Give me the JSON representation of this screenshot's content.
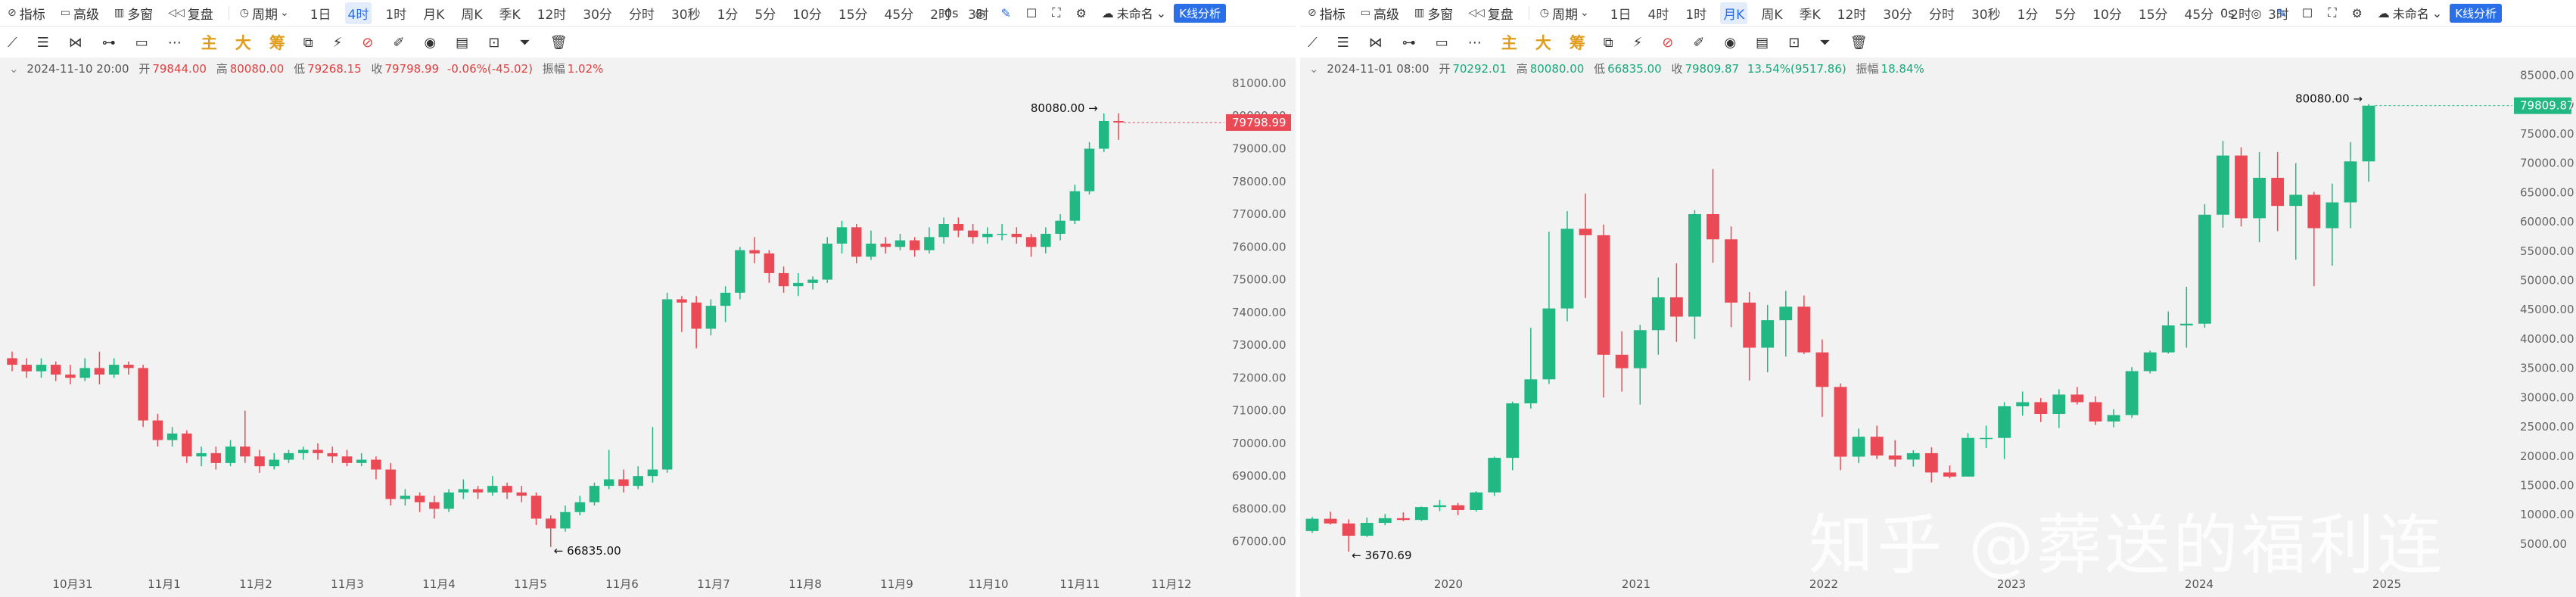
{
  "toolbar": {
    "indicator": "指标",
    "advanced": "高级",
    "multi_window": "多窗",
    "replay": "复盘",
    "period_menu": "周期",
    "unnamed": "未命名",
    "kline_analysis": "K线分析",
    "right_speed": "0s",
    "tools": [
      "主",
      "大",
      "筹"
    ]
  },
  "left": {
    "periods": [
      "1日",
      "4时",
      "1时",
      "月K",
      "周K",
      "季K",
      "12时",
      "30分",
      "分时",
      "30秒",
      "1分",
      "5分",
      "10分",
      "15分",
      "45分",
      "2时",
      "3时"
    ],
    "active_period": "4时",
    "info": {
      "datetime": "2024-11-10 20:00",
      "open_label": "开",
      "open": "79844.00",
      "high_label": "高",
      "high": "80080.00",
      "low_label": "低",
      "low": "79268.15",
      "close_label": "收",
      "close": "79798.99",
      "change": "-0.06%(-45.02)",
      "amp_label": "振幅",
      "amp": "1.02%"
    },
    "chart_data": {
      "type": "candlestick",
      "y_ticks": [
        81000,
        80000,
        79000,
        78000,
        77000,
        76000,
        75000,
        74000,
        73000,
        72000,
        71000,
        70000,
        69000,
        68000,
        67000
      ],
      "ylim": [
        66300,
        81600
      ],
      "x_ticks": [
        "10月31",
        "11月1",
        "11月2",
        "11月3",
        "11月4",
        "11月5",
        "11月6",
        "11月7",
        "11月8",
        "11月9",
        "11月10",
        "11月11",
        "11月12"
      ],
      "last_price": "79798.99",
      "high_label": "80080.00",
      "low_label": "66835.00",
      "candles": [
        [
          72600,
          72400,
          72800,
          72200
        ],
        [
          72400,
          72200,
          72600,
          72000
        ],
        [
          72200,
          72400,
          72600,
          72000
        ],
        [
          72400,
          72100,
          72500,
          71900
        ],
        [
          72100,
          72000,
          72400,
          71800
        ],
        [
          72000,
          72300,
          72600,
          71900
        ],
        [
          72300,
          72100,
          72800,
          71800
        ],
        [
          72100,
          72400,
          72600,
          72000
        ],
        [
          72400,
          72300,
          72500,
          72100
        ],
        [
          72300,
          70700,
          72400,
          70500
        ],
        [
          70700,
          70100,
          70900,
          69900
        ],
        [
          70100,
          70300,
          70500,
          69900
        ],
        [
          70300,
          69600,
          70400,
          69400
        ],
        [
          69600,
          69700,
          69900,
          69300
        ],
        [
          69700,
          69400,
          69900,
          69200
        ],
        [
          69400,
          69900,
          70100,
          69300
        ],
        [
          69900,
          69600,
          71000,
          69400
        ],
        [
          69600,
          69300,
          69800,
          69100
        ],
        [
          69300,
          69500,
          69700,
          69200
        ],
        [
          69500,
          69700,
          69800,
          69400
        ],
        [
          69700,
          69800,
          69900,
          69500
        ],
        [
          69800,
          69700,
          70000,
          69500
        ],
        [
          69700,
          69600,
          69900,
          69400
        ],
        [
          69600,
          69400,
          69800,
          69300
        ],
        [
          69400,
          69500,
          69700,
          69300
        ],
        [
          69500,
          69200,
          69600,
          68900
        ],
        [
          69200,
          68300,
          69400,
          68100
        ],
        [
          68300,
          68400,
          68600,
          68100
        ],
        [
          68400,
          68200,
          68500,
          67900
        ],
        [
          68200,
          68000,
          68400,
          67700
        ],
        [
          68000,
          68500,
          68600,
          67900
        ],
        [
          68500,
          68600,
          68900,
          68300
        ],
        [
          68600,
          68500,
          68700,
          68300
        ],
        [
          68500,
          68700,
          69000,
          68400
        ],
        [
          68700,
          68500,
          68800,
          68300
        ],
        [
          68500,
          68400,
          68700,
          68200
        ],
        [
          68400,
          67700,
          68500,
          67500
        ],
        [
          67700,
          67400,
          67800,
          66835
        ],
        [
          67400,
          67900,
          68100,
          67300
        ],
        [
          67900,
          68200,
          68400,
          67800
        ],
        [
          68200,
          68700,
          68800,
          68100
        ],
        [
          68700,
          68900,
          69800,
          68600
        ],
        [
          68900,
          68700,
          69200,
          68500
        ],
        [
          68700,
          69000,
          69300,
          68600
        ],
        [
          69000,
          69200,
          70500,
          68800
        ],
        [
          69200,
          74400,
          74600,
          69100
        ],
        [
          74400,
          74300,
          74500,
          73400
        ],
        [
          74300,
          73500,
          74500,
          72900
        ],
        [
          73500,
          74200,
          74400,
          73300
        ],
        [
          74200,
          74600,
          74800,
          73700
        ],
        [
          74600,
          75900,
          76000,
          74400
        ],
        [
          75900,
          75800,
          76300,
          75500
        ],
        [
          75800,
          75200,
          75900,
          74900
        ],
        [
          75200,
          74800,
          75400,
          74600
        ],
        [
          74800,
          74900,
          75200,
          74500
        ],
        [
          74900,
          75000,
          75100,
          74700
        ],
        [
          75000,
          76100,
          76300,
          74900
        ],
        [
          76100,
          76600,
          76800,
          75800
        ],
        [
          76600,
          75700,
          76700,
          75500
        ],
        [
          75700,
          76100,
          76500,
          75600
        ],
        [
          76100,
          76000,
          76300,
          75800
        ],
        [
          76000,
          76200,
          76400,
          75900
        ],
        [
          76200,
          75900,
          76300,
          75700
        ],
        [
          75900,
          76300,
          76600,
          75800
        ],
        [
          76300,
          76700,
          76900,
          76100
        ],
        [
          76700,
          76500,
          76900,
          76300
        ],
        [
          76500,
          76300,
          76700,
          76100
        ],
        [
          76300,
          76400,
          76600,
          76100
        ],
        [
          76400,
          76400,
          76700,
          76200
        ],
        [
          76400,
          76300,
          76600,
          76100
        ],
        [
          76300,
          76000,
          76400,
          75700
        ],
        [
          76000,
          76400,
          76600,
          75800
        ],
        [
          76400,
          76800,
          77000,
          76200
        ],
        [
          76800,
          77700,
          77900,
          76700
        ],
        [
          77700,
          79000,
          79200,
          77600
        ],
        [
          79000,
          79844,
          80080,
          78900
        ],
        [
          79844,
          79799,
          80080,
          79268
        ]
      ]
    }
  },
  "right": {
    "periods": [
      "1日",
      "4时",
      "1时",
      "月K",
      "周K",
      "季K",
      "12时",
      "30分",
      "分时",
      "30秒",
      "1分",
      "5分",
      "10分",
      "15分",
      "45分",
      "2时",
      "3时"
    ],
    "active_period": "月K",
    "info": {
      "datetime": "2024-11-01 08:00",
      "open_label": "开",
      "open": "70292.01",
      "high_label": "高",
      "high": "80080.00",
      "low_label": "低",
      "low": "66835.00",
      "close_label": "收",
      "close": "79809.87",
      "change": "13.54%(9517.86)",
      "amp_label": "振幅",
      "amp": "18.84%"
    },
    "chart_data": {
      "type": "candlestick",
      "y_ticks": [
        85000,
        80000,
        75000,
        70000,
        65000,
        60000,
        55000,
        50000,
        45000,
        40000,
        35000,
        30000,
        25000,
        20000,
        15000,
        10000,
        5000
      ],
      "ylim": [
        1500,
        87000
      ],
      "x_ticks": [
        "2020",
        "2021",
        "2022",
        "2023",
        "2024",
        "2025"
      ],
      "last_price": "79809.87",
      "high_label": "80080.00",
      "low_label": "3670.69",
      "candles": [
        [
          7200,
          9300,
          9600,
          6900
        ],
        [
          9300,
          8500,
          10500,
          8300
        ],
        [
          8500,
          6400,
          9200,
          3670
        ],
        [
          6400,
          8600,
          9500,
          6200
        ],
        [
          8600,
          9400,
          10100,
          8200
        ],
        [
          9400,
          9100,
          10400,
          8900
        ],
        [
          9100,
          11300,
          11400,
          8900
        ],
        [
          11300,
          11600,
          12500,
          10600
        ],
        [
          11600,
          10800,
          12000,
          9900
        ],
        [
          10800,
          13800,
          14000,
          10500
        ],
        [
          13800,
          19700,
          19900,
          13200
        ],
        [
          19700,
          29000,
          29300,
          17600
        ],
        [
          29000,
          33100,
          41900,
          28100
        ],
        [
          33100,
          45200,
          58300,
          32300
        ],
        [
          45200,
          58800,
          61800,
          43000
        ],
        [
          58800,
          57700,
          64800,
          47000
        ],
        [
          57700,
          37300,
          59500,
          30000
        ],
        [
          37300,
          35000,
          41300,
          31000
        ],
        [
          35000,
          41500,
          42400,
          28800
        ],
        [
          41500,
          47100,
          50500,
          37300
        ],
        [
          47100,
          43800,
          52900,
          39500
        ],
        [
          43800,
          61300,
          62000,
          40000
        ],
        [
          61300,
          57000,
          69000,
          53000
        ],
        [
          57000,
          46200,
          59200,
          42000
        ],
        [
          46200,
          38500,
          48000,
          32900
        ],
        [
          38500,
          43200,
          45800,
          34300
        ],
        [
          43200,
          45500,
          48200,
          37000
        ],
        [
          45500,
          37700,
          47400,
          37400
        ],
        [
          37700,
          31800,
          39900,
          26700
        ],
        [
          31800,
          19900,
          32400,
          17600
        ],
        [
          19900,
          23300,
          24700,
          18800
        ],
        [
          23300,
          20100,
          25200,
          19500
        ],
        [
          20100,
          19400,
          22700,
          18200
        ],
        [
          19400,
          20500,
          21000,
          18200
        ],
        [
          20500,
          17200,
          21500,
          15500
        ],
        [
          17200,
          16500,
          18400,
          16200
        ],
        [
          16500,
          23100,
          23900,
          16500
        ],
        [
          23100,
          23100,
          25200,
          21400
        ],
        [
          23100,
          28500,
          29200,
          19500
        ],
        [
          28500,
          29200,
          31000,
          26900
        ],
        [
          29200,
          27200,
          29900,
          25800
        ],
        [
          27200,
          30500,
          31400,
          24800
        ],
        [
          30500,
          29200,
          31800,
          28800
        ],
        [
          29200,
          25900,
          30200,
          25300
        ],
        [
          25900,
          27000,
          28000,
          24900
        ],
        [
          27000,
          34500,
          35200,
          26500
        ],
        [
          34500,
          37700,
          38000,
          34100
        ],
        [
          37700,
          42300,
          44700,
          37500
        ],
        [
          42300,
          42600,
          48900,
          38500
        ],
        [
          42600,
          61200,
          63000,
          41900
        ],
        [
          61200,
          71300,
          73800,
          59000
        ],
        [
          71300,
          60600,
          72700,
          59200
        ],
        [
          60600,
          67500,
          71900,
          56500
        ],
        [
          67500,
          62700,
          71900,
          58400
        ],
        [
          62700,
          64600,
          70000,
          53500
        ],
        [
          64600,
          58900,
          65100,
          49000
        ],
        [
          58900,
          63300,
          66500,
          52500
        ],
        [
          63300,
          70300,
          73600,
          58900
        ],
        [
          70300,
          79810,
          80080,
          66835
        ]
      ]
    }
  },
  "watermark": "知乎 @葬送的福利连"
}
